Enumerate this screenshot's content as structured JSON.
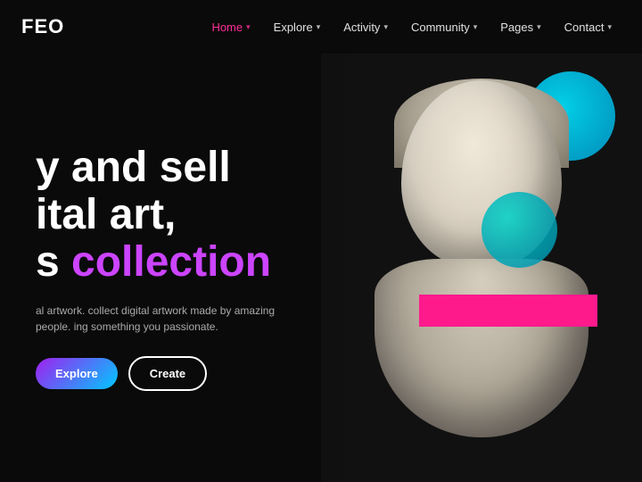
{
  "logo": {
    "text": "FEO"
  },
  "nav": {
    "items": [
      {
        "label": "Home",
        "has_dropdown": true,
        "active": true
      },
      {
        "label": "Explore",
        "has_dropdown": true,
        "active": false
      },
      {
        "label": "Activity",
        "has_dropdown": true,
        "active": false
      },
      {
        "label": "Community",
        "has_dropdown": true,
        "active": false
      },
      {
        "label": "Pages",
        "has_dropdown": true,
        "active": false
      },
      {
        "label": "Contact",
        "has_dropdown": true,
        "active": false
      }
    ]
  },
  "hero": {
    "title_line1": "y and sell",
    "title_line2": "ital art,",
    "title_line3_part1": "s ",
    "title_line3_part2": "collection",
    "subtitle": "al artwork. collect digital artwork made by amazing people. ing something you passionate.",
    "btn_explore_label": "Explore",
    "btn_create_label": "Create"
  }
}
